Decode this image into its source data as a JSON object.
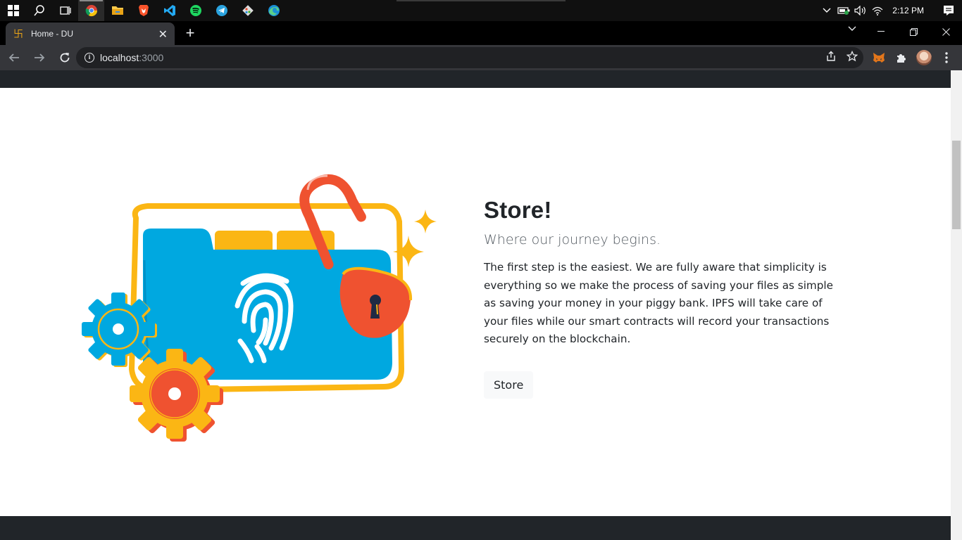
{
  "taskbar": {
    "apps": [
      "start",
      "search",
      "task-view",
      "chrome",
      "file-explorer",
      "brave",
      "vscode",
      "spotify",
      "telegram",
      "git",
      "edge"
    ],
    "clock": "2:12 PM"
  },
  "browser": {
    "tab": {
      "title": "Home - DU"
    },
    "address": {
      "host": "localhost",
      "port": ":3000"
    }
  },
  "page": {
    "title": "Store!",
    "lead": "Where our journey begins.",
    "body": "The first step is the easiest. We are fully aware that simplicity is everything so we make the process of saving your files as simple as saving your money in your piggy bank. IPFS will take care of your files while our smart contracts will record your transactions securely on the blockchain.",
    "button": "Store"
  },
  "colors": {
    "folder_blue": "#00a8e0",
    "accent_yellow": "#fbb614",
    "accent_red": "#ef5230",
    "dark_bar": "#212529"
  }
}
